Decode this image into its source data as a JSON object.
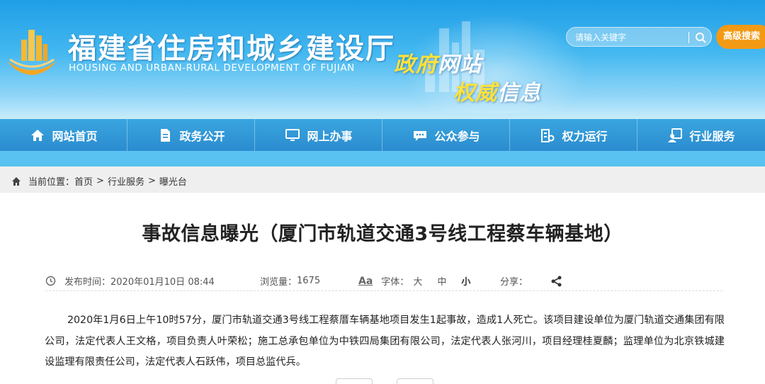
{
  "header": {
    "site_title": "福建省住房和城乡建设厅",
    "site_subtitle": "HOUSING AND URBAN-RURAL DEVELOPMENT OF FUJIAN",
    "slogan_line1_a": "政府",
    "slogan_line1_b": "网站",
    "slogan_line2_a": "权威",
    "slogan_line2_b": "信息",
    "search_placeholder": "请输入关键字",
    "advanced_search_label": "高级搜索",
    "colors": {
      "accent_orange": "#f39a14",
      "nav_blue": "#2b8ccf",
      "slogan_yellow": "#ffe23a"
    }
  },
  "nav": {
    "items": [
      {
        "label": "网站首页",
        "icon": "home-icon"
      },
      {
        "label": "政务公开",
        "icon": "document-icon"
      },
      {
        "label": "网上办事",
        "icon": "monitor-icon"
      },
      {
        "label": "公众参与",
        "icon": "chat-icon"
      },
      {
        "label": "权力运行",
        "icon": "building-icon"
      },
      {
        "label": "行业服务",
        "icon": "people-icon"
      }
    ]
  },
  "breadcrumb": {
    "prefix": "当前位置：",
    "items": [
      "首页",
      "行业服务",
      "曝光台"
    ],
    "separator": ">"
  },
  "article": {
    "title": "事故信息曝光（厦门市轨道交通3号线工程蔡车辆基地）",
    "publish_label": "发布时间：",
    "publish_time": "2020年01月10日 08:44",
    "views_label": "浏览量：",
    "views": "1675",
    "font_label": "字体：",
    "font_sizes": [
      "大",
      "中",
      "小"
    ],
    "font_icon_text": "Aa",
    "share_label": "分享：",
    "body": "2020年1月6日上午10时57分，厦门市轨道交通3号线工程蔡厝车辆基地项目发生1起事故，造成1人死亡。该项目建设单位为厦门轨道交通集团有限公司，法定代表人王文格，项目负责人叶荣松；施工总承包单位为中铁四局集团有限公司，法定代表人张河川，项目经理桂夏麟；监理单位为北京铁城建设监理有限责任公司，法定代表人石跃伟，项目总监代兵。"
  }
}
